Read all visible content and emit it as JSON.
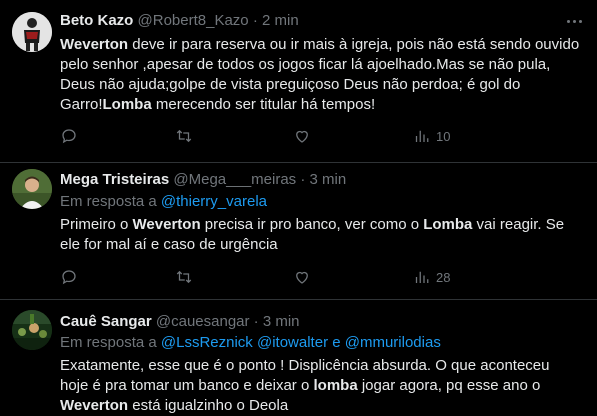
{
  "colors": {
    "background": "#000000",
    "text": "#e7e9ea",
    "muted": "#71767b",
    "link": "#1d9bf0",
    "divider": "#2f3336"
  },
  "tweets": [
    {
      "name": "Beto Kazo",
      "handle": "@Robert8_Kazo",
      "sep": "·",
      "time": "2 min",
      "reply_prefix": "",
      "reply_to": "",
      "text_parts": [
        {
          "t": "Weverton",
          "b": true
        },
        {
          "t": " deve ir para reserva ou ir mais à igreja, pois não está sendo ouvido pelo senhor ,apesar de todos os jogos ficar lá ajoelhado.Mas se não pula, Deus não ajuda;golpe de vista preguiçoso Deus não perdoa; é gol do Garro!",
          "b": false
        },
        {
          "t": "Lomba",
          "b": true
        },
        {
          "t": " merecendo ser titular há tempos!",
          "b": false
        }
      ],
      "views": "10",
      "icons": [
        "reply-icon",
        "retweet-icon",
        "like-icon",
        "views-icon"
      ]
    },
    {
      "name": "Mega Tristeiras",
      "handle": "@Mega___meiras",
      "sep": "·",
      "time": "3 min",
      "reply_prefix": "Em resposta a",
      "reply_to": "@thierry_varela",
      "text_parts": [
        {
          "t": "Primeiro o ",
          "b": false
        },
        {
          "t": "Weverton",
          "b": true
        },
        {
          "t": " precisa ir pro banco, ver como o ",
          "b": false
        },
        {
          "t": "Lomba",
          "b": true
        },
        {
          "t": " vai reagir. Se ele for mal aí e caso de urgência",
          "b": false
        }
      ],
      "views": "28",
      "icons": [
        "reply-icon",
        "retweet-icon",
        "like-icon",
        "views-icon"
      ]
    },
    {
      "name": "Cauê Sangar",
      "handle": "@cauesangar",
      "sep": "·",
      "time": "3 min",
      "reply_prefix": "Em resposta a",
      "reply_to": "@LssReznick @itowalter e @mmurilodias",
      "text_parts": [
        {
          "t": "Exatamente, esse que é o ponto ! Displicência absurda. O que aconteceu hoje é pra tomar um banco e deixar o ",
          "b": false
        },
        {
          "t": "lomba",
          "b": true
        },
        {
          "t": " jogar agora, pq esse ano o ",
          "b": false
        },
        {
          "t": "Weverton",
          "b": true
        },
        {
          "t": " está igualzinho o Deola",
          "b": false
        }
      ],
      "views": "",
      "icons": []
    }
  ]
}
